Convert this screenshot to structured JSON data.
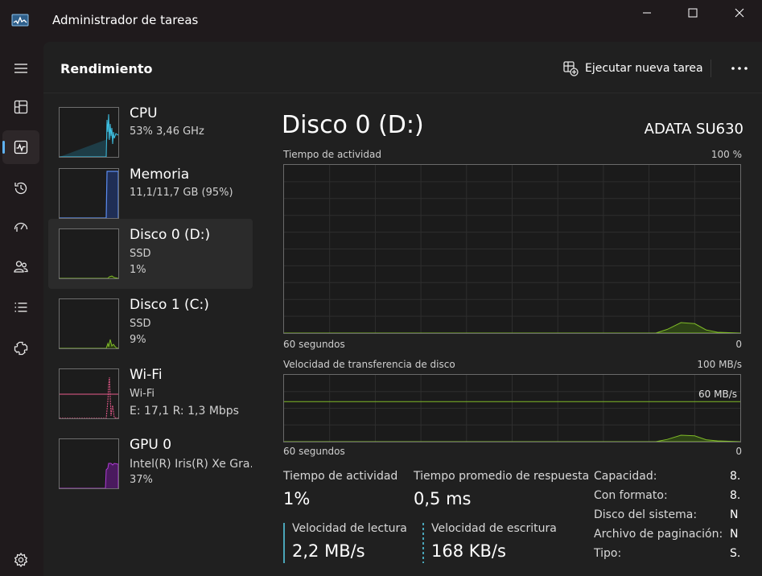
{
  "window": {
    "title": "Administrador de tareas"
  },
  "header": {
    "page_title": "Rendimiento",
    "run_task_label": "Ejecutar nueva tarea"
  },
  "nav": {
    "items": [
      "menu-icon",
      "processes-icon",
      "performance-icon",
      "app-history-icon",
      "startup-icon",
      "users-icon",
      "details-icon",
      "services-icon",
      "settings-icon"
    ],
    "active": "performance-icon"
  },
  "resources": [
    {
      "name": "CPU",
      "sub1": "53%  3,46 GHz",
      "sub2": "",
      "color": "#3ec3e6"
    },
    {
      "name": "Memoria",
      "sub1": "11,1/11,7 GB (95%)",
      "sub2": "",
      "color": "#5b8cf0"
    },
    {
      "name": "Disco 0 (D:)",
      "sub1": "SSD",
      "sub2": "1%",
      "color": "#7fba28"
    },
    {
      "name": "Disco 1 (C:)",
      "sub1": "SSD",
      "sub2": "9%",
      "color": "#7fba28"
    },
    {
      "name": "Wi-Fi",
      "sub1": "Wi-Fi",
      "sub2": "E: 17,1  R: 1,3 Mbps",
      "color": "#e85a8c"
    },
    {
      "name": "GPU 0",
      "sub1": "Intel(R) Iris(R) Xe Gra...",
      "sub2": "37%",
      "color": "#b03cd6"
    }
  ],
  "detail": {
    "title": "Disco 0 (D:)",
    "model": "ADATA SU630",
    "graph1": {
      "label": "Tiempo de actividad",
      "max": "100 %",
      "time_label": "60 segundos",
      "min": "0"
    },
    "graph2": {
      "label": "Velocidad de transferencia de disco",
      "max": "100 MB/s",
      "line_label": "60 MB/s",
      "line_level": 0.6,
      "time_label": "60 segundos",
      "min": "0"
    },
    "stats": {
      "active_time_label": "Tiempo de actividad",
      "active_time_value": "1%",
      "response_label": "Tiempo promedio de respuesta",
      "response_value": "0,5 ms",
      "read_label": "Velocidad de lectura",
      "read_value": "2,2 MB/s",
      "write_label": "Velocidad de escritura",
      "write_value": "168 KB/s"
    },
    "props": [
      {
        "label": "Capacidad:",
        "value": "8."
      },
      {
        "label": "Con formato:",
        "value": "8."
      },
      {
        "label": "Disco del sistema:",
        "value": "N"
      },
      {
        "label": "Archivo de paginación:",
        "value": "N"
      },
      {
        "label": "Tipo:",
        "value": "S."
      }
    ]
  },
  "colors": {
    "disk_accent": "#7fba28",
    "nav_accent": "#5fb2f2"
  }
}
